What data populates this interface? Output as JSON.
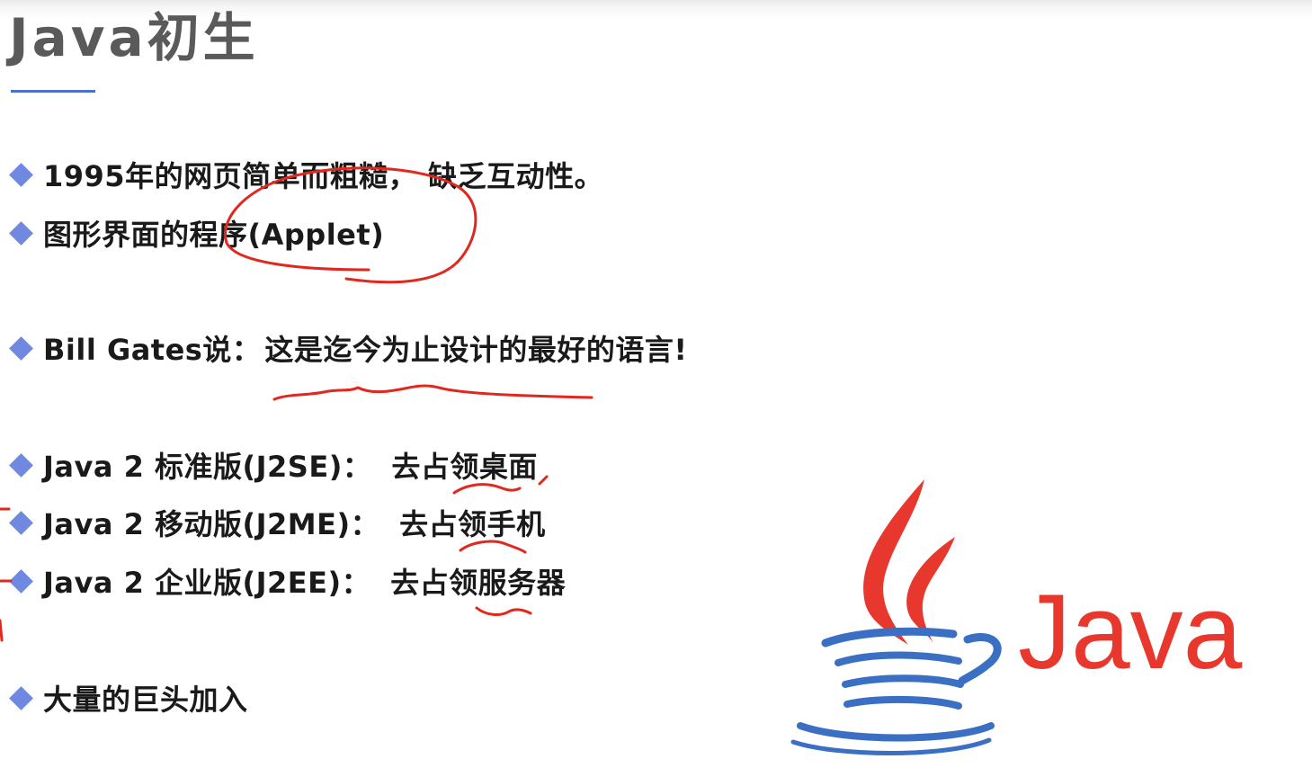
{
  "slide": {
    "title": "Java初生",
    "bullets": [
      {
        "main": "1995年的网页简单而粗糙，",
        "detail": "缺乏互动性。"
      },
      {
        "main": "图形界面的程序(Applet)",
        "detail": ""
      },
      {
        "main": "Bill Gates说：",
        "detail": "这是迄今为止设计的最好的语言!"
      },
      {
        "main": "Java 2 标准版(J2SE)：",
        "detail": "去占领桌面"
      },
      {
        "main": "Java 2 移动版(J2ME)：",
        "detail": "去占领手机"
      },
      {
        "main": "Java 2 企业版(J2EE)：",
        "detail": "去占领服务器"
      },
      {
        "main": "大量的巨头加入",
        "detail": ""
      }
    ]
  },
  "logo": {
    "wordmark": "Java",
    "flame_color": "#e8372d",
    "cup_color": "#3a6fc4",
    "text_color": "#e8372d"
  },
  "colors": {
    "title": "#5a5a5a",
    "accent_line": "#4c6fd0",
    "bullet_diamond": "#7089e0",
    "annotation": "#e0281e"
  }
}
